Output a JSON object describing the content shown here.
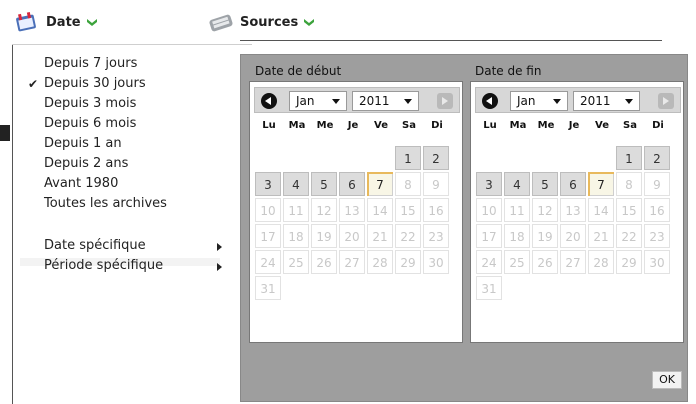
{
  "toolbar": {
    "date_label": "Date",
    "sources_label": "Sources",
    "chevron": "❯",
    "icons": {
      "date": "calendar-icon",
      "sources": "sources-icon"
    }
  },
  "menu": {
    "items": [
      {
        "label": "Depuis 7 jours",
        "checked": false
      },
      {
        "label": "Depuis 30 jours",
        "checked": true
      },
      {
        "label": "Depuis 3 mois",
        "checked": false
      },
      {
        "label": "Depuis 6 mois",
        "checked": false
      },
      {
        "label": "Depuis 1 an",
        "checked": false
      },
      {
        "label": "Depuis 2 ans",
        "checked": false
      },
      {
        "label": "Avant 1980",
        "checked": false
      },
      {
        "label": "Toutes les archives",
        "checked": false
      }
    ],
    "submenus": [
      {
        "label": "Date spécifique"
      },
      {
        "label": "Période spécifique"
      }
    ],
    "check_glyph": "✔"
  },
  "calendars": {
    "start": {
      "title": "Date de début",
      "month": "Jan",
      "year": "2011"
    },
    "end": {
      "title": "Date de fin",
      "month": "Jan",
      "year": "2011"
    },
    "weekdays": [
      "Lu",
      "Ma",
      "Me",
      "Je",
      "Ve",
      "Sa",
      "Di"
    ],
    "weeks": [
      [
        "",
        "",
        "",
        "",
        "",
        "1",
        "2"
      ],
      [
        "3",
        "4",
        "5",
        "6",
        "7",
        "8",
        "9"
      ],
      [
        "10",
        "11",
        "12",
        "13",
        "14",
        "15",
        "16"
      ],
      [
        "17",
        "18",
        "19",
        "20",
        "21",
        "22",
        "23"
      ],
      [
        "24",
        "25",
        "26",
        "27",
        "28",
        "29",
        "30"
      ],
      [
        "31",
        "",
        "",
        "",
        "",
        "",
        ""
      ]
    ],
    "available_days": [
      "1",
      "2",
      "3",
      "4",
      "5",
      "6",
      "7"
    ],
    "today": "7"
  },
  "ok_label": "OK"
}
